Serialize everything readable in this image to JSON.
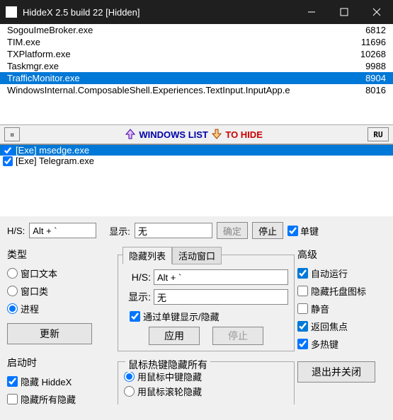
{
  "window": {
    "title": "HiddeX 2.5 build 22 [Hidden]"
  },
  "processes": [
    {
      "name": "SogouImeBroker.exe",
      "pid": "6812",
      "sel": false
    },
    {
      "name": "TIM.exe",
      "pid": "11696",
      "sel": false
    },
    {
      "name": "TXPlatform.exe",
      "pid": "10268",
      "sel": false
    },
    {
      "name": "Taskmgr.exe",
      "pid": "9988",
      "sel": false
    },
    {
      "name": "TrafficMonitor.exe",
      "pid": "8904",
      "sel": true
    },
    {
      "name": "WindowsInternal.ComposableShell.Experiences.TextInput.InputApp.e",
      "pid": "8016",
      "sel": false
    }
  ],
  "arrowbar": {
    "left_glyph": "¤",
    "windows_list": "WINDOWS LIST",
    "to_hide": "TO HIDE",
    "ru": "RU"
  },
  "hidelist": [
    {
      "label": "[Exe] msedge.exe",
      "sel": true
    },
    {
      "label": "[Exe] Telegram.exe",
      "sel": false
    }
  ],
  "hs_row": {
    "hs_label": "H/S:",
    "hs_value": "Alt + `",
    "show_label": "显示:",
    "show_value": "无",
    "confirm": "确定",
    "stop": "停止",
    "single_key": "单键"
  },
  "type": {
    "title": "类型",
    "opt_text": "窗口文本",
    "opt_class": "窗口类",
    "opt_proc": "进程",
    "update": "更新"
  },
  "startup": {
    "title": "启动时",
    "hide_hiddex": "隐藏 HiddeX",
    "hide_all": "隐藏所有隐藏"
  },
  "hidelist_tab": {
    "tab1": "隐藏列表",
    "tab2": "活动窗口",
    "hs_label": "H/S:",
    "hs_value": "Alt + `",
    "show_label": "显示:",
    "show_value": "无",
    "by_single": "通过单键显示/隐藏",
    "apply": "应用",
    "stop": "停止"
  },
  "mouse": {
    "title": "鼠标热键隐藏所有",
    "middle": "用鼠标中键隐藏",
    "wheel": "用鼠标滚轮隐藏"
  },
  "advanced": {
    "title": "高级",
    "autorun": "自动运行",
    "hide_tray": "隐藏托盘图标",
    "mute": "静音",
    "return_focus": "返回焦点",
    "multi_hotkey": "多热键",
    "exit": "退出并关闭"
  }
}
